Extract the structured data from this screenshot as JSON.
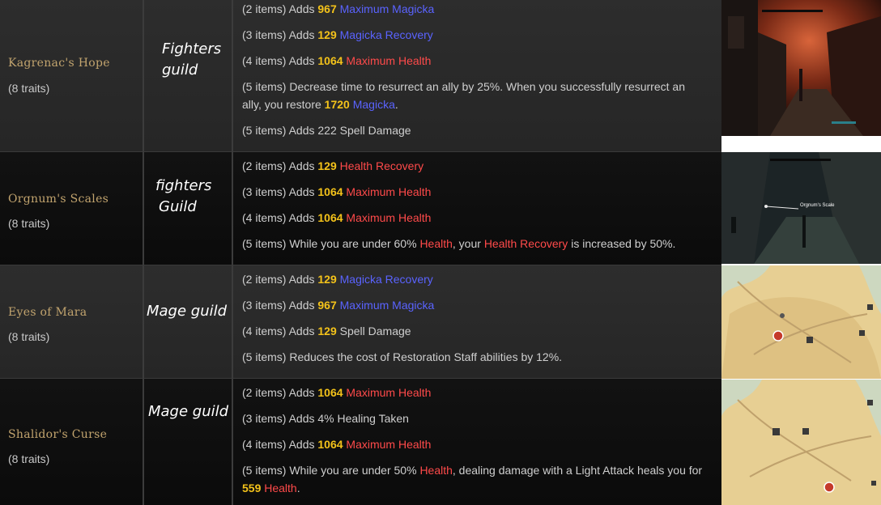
{
  "sets": [
    {
      "name": "Kagrenac's Hope",
      "traits": "(8 traits)",
      "guild_line1": "Fighters",
      "guild_line2": "guild",
      "bonuses": [
        {
          "pre": "(2 items) Adds ",
          "num": "967",
          "stat": "Maximum Magicka",
          "post": ""
        },
        {
          "pre": "(3 items) Adds ",
          "num": "129",
          "stat": "Magicka Recovery",
          "post": ""
        },
        {
          "pre": "(4 items) Adds ",
          "num": "1064",
          "stat": "Maximum Health",
          "post": ""
        },
        {
          "pre": "(5 items)  Decrease time to resurrect an ally by 25%. When you successfully resurrect an ally, you restore ",
          "num": "1720",
          "stat": "Magicka",
          "post": "."
        },
        {
          "pre": "(5 items) Adds 222 Spell Damage",
          "num": "",
          "stat": "",
          "post": ""
        }
      ]
    },
    {
      "name": "Orgnum's Scales",
      "traits": "(8 traits)",
      "guild_line1": "fighters",
      "guild_line2": "Guild",
      "bonuses": [
        {
          "pre": "(2 items) Adds ",
          "num": "129",
          "stat": "Health Recovery",
          "post": ""
        },
        {
          "pre": "(3 items) Adds ",
          "num": "1064",
          "stat": "Maximum Health",
          "post": ""
        },
        {
          "pre": "(4 items) Adds ",
          "num": "1064",
          "stat": "Maximum Health",
          "post": ""
        },
        {
          "pre": "(5 items) While you are under 60% ",
          "num": "",
          "stat": "Health",
          "mid": ", your ",
          "stat2": "Health Recovery",
          "post": " is increased by 50%."
        }
      ]
    },
    {
      "name": "Eyes of Mara",
      "traits": "(8 traits)",
      "guild_line1": "Mage guild",
      "guild_line2": "",
      "bonuses": [
        {
          "pre": "(2 items) Adds ",
          "num": "129",
          "stat": "Magicka Recovery",
          "post": ""
        },
        {
          "pre": "(3 items) Adds ",
          "num": "967",
          "stat": "Maximum Magicka",
          "post": ""
        },
        {
          "pre": "(4 items) Adds ",
          "num": "129",
          "stat": "",
          "post": " Spell Damage"
        },
        {
          "pre": "(5 items) Reduces the cost of Restoration Staff abilities by 12%.",
          "num": "",
          "stat": "",
          "post": ""
        }
      ]
    },
    {
      "name": "Shalidor's Curse",
      "traits": "(8 traits)",
      "guild_line1": "Mage guild",
      "guild_line2": "",
      "bonuses": [
        {
          "pre": "(2 items) Adds ",
          "num": "1064",
          "stat": "Maximum Health",
          "post": ""
        },
        {
          "pre": "(3 items) Adds 4% Healing Taken",
          "num": "",
          "stat": "",
          "post": ""
        },
        {
          "pre": "(4 items) Adds ",
          "num": "1064",
          "stat": "Maximum Health",
          "post": ""
        },
        {
          "pre": "(5 items) While you are under 50% ",
          "num": "",
          "stat": "Health",
          "mid": ", dealing damage with a Light Attack heals you for ",
          "num2": "559",
          "stat2": "Health",
          "post": "."
        }
      ]
    }
  ],
  "screenshots": {
    "orgnum_marker_label": "Orgnum's Scale"
  },
  "colors": {
    "set_name": "#c2a46e",
    "number": "#f3c21a",
    "magicka": "#5a63ff",
    "health": "#ff4a4a"
  }
}
